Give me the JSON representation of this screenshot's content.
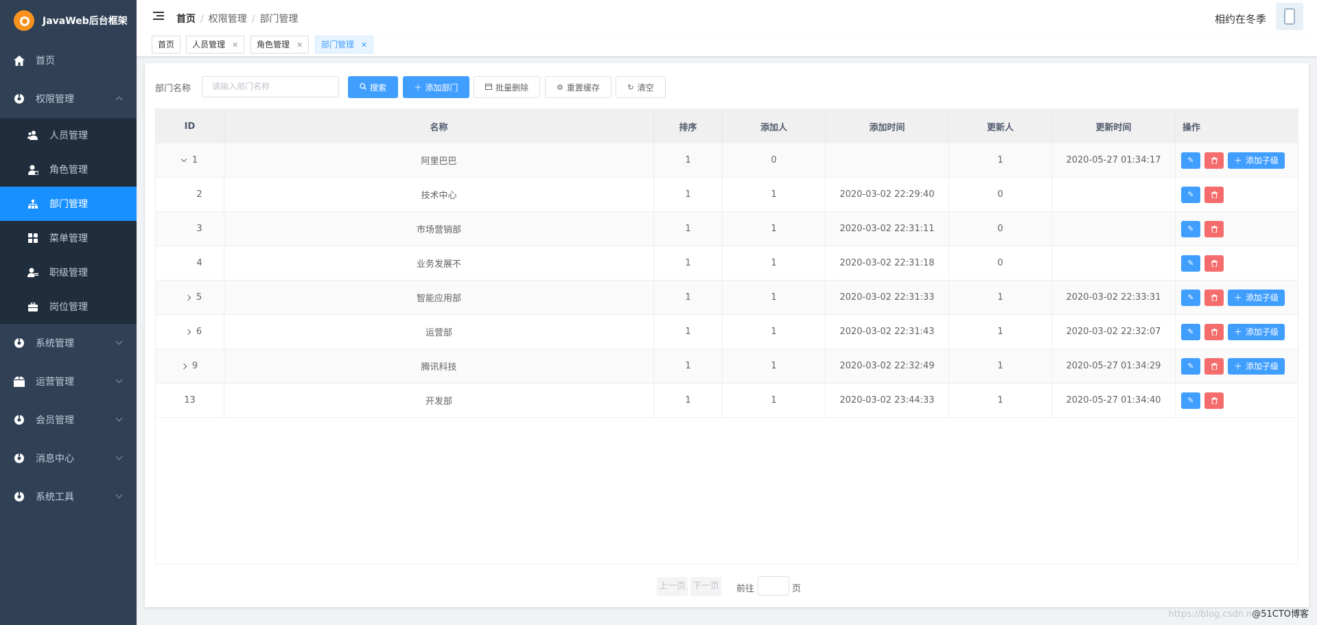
{
  "app": {
    "title": "JavaWeb后台框架"
  },
  "sidebar": {
    "items": [
      {
        "label": "首页",
        "icon": "home-icon"
      },
      {
        "label": "权限管理",
        "icon": "permission-icon",
        "expanded": true,
        "children": [
          {
            "label": "人员管理",
            "icon": "users-icon"
          },
          {
            "label": "角色管理",
            "icon": "role-icon"
          },
          {
            "label": "部门管理",
            "icon": "org-tree-icon",
            "active": true
          },
          {
            "label": "菜单管理",
            "icon": "grid-icon"
          },
          {
            "label": "职级管理",
            "icon": "rank-icon"
          },
          {
            "label": "岗位管理",
            "icon": "briefcase-icon"
          }
        ]
      },
      {
        "label": "系统管理",
        "icon": "gear-icon"
      },
      {
        "label": "运营管理",
        "icon": "box-icon"
      },
      {
        "label": "会员管理",
        "icon": "member-icon"
      },
      {
        "label": "消息中心",
        "icon": "message-icon"
      },
      {
        "label": "系统工具",
        "icon": "tool-icon"
      }
    ]
  },
  "navbar": {
    "breadcrumb": [
      "首页",
      "权限管理",
      "部门管理"
    ],
    "username": "相约在冬季"
  },
  "tags": [
    {
      "label": "首页",
      "closable": false
    },
    {
      "label": "人员管理",
      "closable": true
    },
    {
      "label": "角色管理",
      "closable": true
    },
    {
      "label": "部门管理",
      "closable": true,
      "active": true
    }
  ],
  "search": {
    "label": "部门名称",
    "placeholder": "请输入部门名称",
    "buttons": {
      "search": "搜索",
      "add": "添加部门",
      "batch_delete": "批量删除",
      "reset_cache": "重置缓存",
      "clear": "清空"
    }
  },
  "table": {
    "columns": [
      "ID",
      "名称",
      "排序",
      "添加人",
      "添加时间",
      "更新人",
      "更新时间",
      "操作"
    ],
    "add_child_label": "添加子级",
    "rows": [
      {
        "id": "1",
        "name": "阿里巴巴",
        "sort": "1",
        "creator": "0",
        "created": "",
        "updater": "1",
        "updated": "2020-05-27 01:34:17",
        "expand": "down",
        "add_child": true
      },
      {
        "id": "2",
        "name": "技术中心",
        "sort": "1",
        "creator": "1",
        "created": "2020-03-02 22:29:40",
        "updater": "0",
        "updated": "",
        "expand": "none-child",
        "add_child": false
      },
      {
        "id": "3",
        "name": "市场营销部",
        "sort": "1",
        "creator": "1",
        "created": "2020-03-02 22:31:11",
        "updater": "0",
        "updated": "",
        "expand": "none-child",
        "add_child": false
      },
      {
        "id": "4",
        "name": "业务发展不",
        "sort": "1",
        "creator": "1",
        "created": "2020-03-02 22:31:18",
        "updater": "0",
        "updated": "",
        "expand": "none-child",
        "add_child": false
      },
      {
        "id": "5",
        "name": "智能应用部",
        "sort": "1",
        "creator": "1",
        "created": "2020-03-02 22:31:33",
        "updater": "1",
        "updated": "2020-03-02 22:33:31",
        "expand": "right-child",
        "add_child": true
      },
      {
        "id": "6",
        "name": "运营部",
        "sort": "1",
        "creator": "1",
        "created": "2020-03-02 22:31:43",
        "updater": "1",
        "updated": "2020-03-02 22:32:07",
        "expand": "right-child",
        "add_child": true
      },
      {
        "id": "9",
        "name": "腾讯科技",
        "sort": "1",
        "creator": "1",
        "created": "2020-03-02 22:32:49",
        "updater": "1",
        "updated": "2020-05-27 01:34:29",
        "expand": "right",
        "add_child": true
      },
      {
        "id": "13",
        "name": "开发部",
        "sort": "1",
        "creator": "1",
        "created": "2020-03-02 23:44:33",
        "updater": "1",
        "updated": "2020-05-27 01:34:40",
        "expand": "none",
        "add_child": false
      }
    ]
  },
  "pagination": {
    "prev": "上一页",
    "next": "下一页",
    "goto": "前往",
    "page_unit": "页"
  },
  "watermark": {
    "prefix": "https://blog.csdn.n",
    "brand": "@51CTO博客"
  },
  "colors": {
    "sidebar_bg": "#304156",
    "active": "#1890ff",
    "primary": "#409eff",
    "danger": "#f56c6c"
  }
}
